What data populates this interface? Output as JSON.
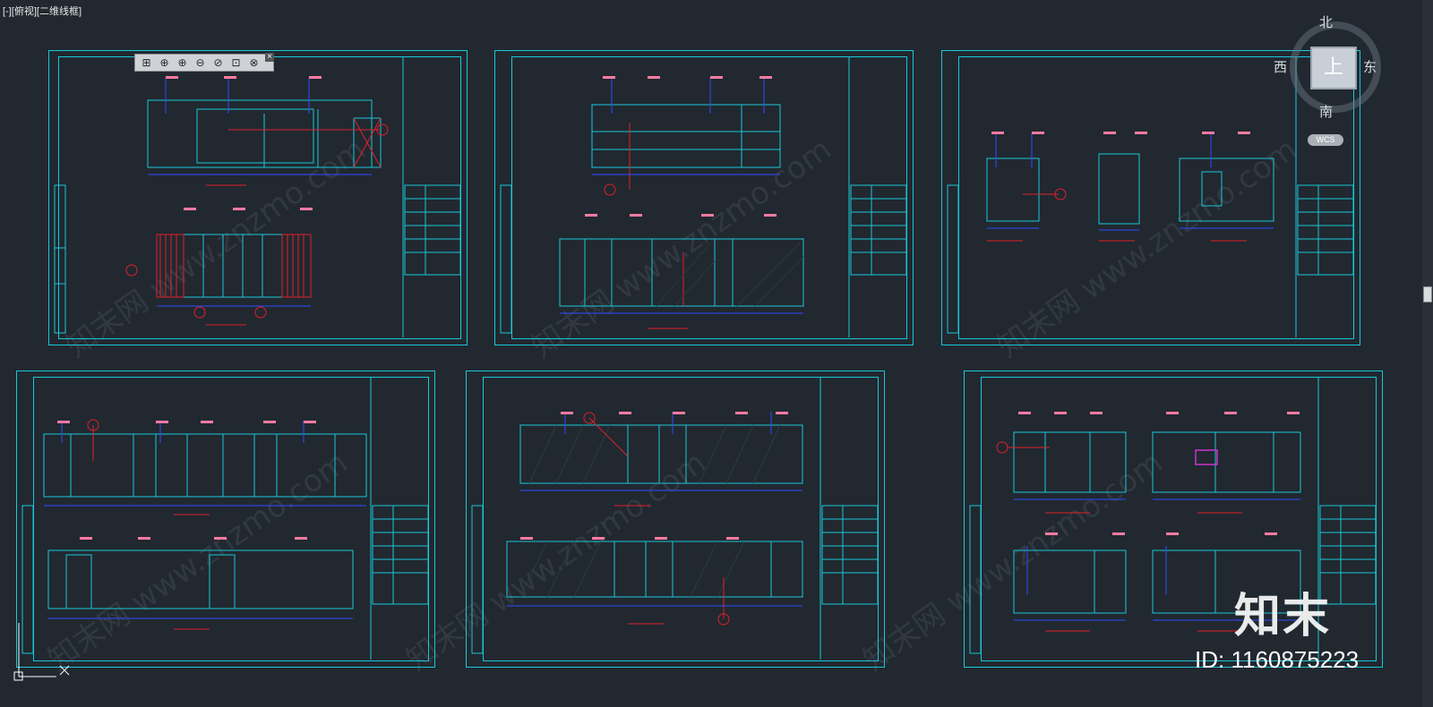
{
  "viewport": {
    "label": "[-][俯视][二维线框]"
  },
  "viewcube": {
    "north": "北",
    "south": "南",
    "east": "东",
    "west": "西",
    "face": "上",
    "wcs": "WCS"
  },
  "toolbar": {
    "buttons": [
      "⊞",
      "⊕",
      "⊕",
      "⊖",
      "⊘",
      "⊡",
      "⊗"
    ],
    "close": "×"
  },
  "watermark": {
    "logo": "知末",
    "id": "ID: 1160875223",
    "diagonal": "知末网 www.znzmo.com"
  },
  "colors": {
    "background": "#212830",
    "frame": "#19c8d8",
    "accent_red": "#e0202a",
    "dim_blue": "#2e4bff",
    "tag_pink": "#ff7aa0"
  }
}
